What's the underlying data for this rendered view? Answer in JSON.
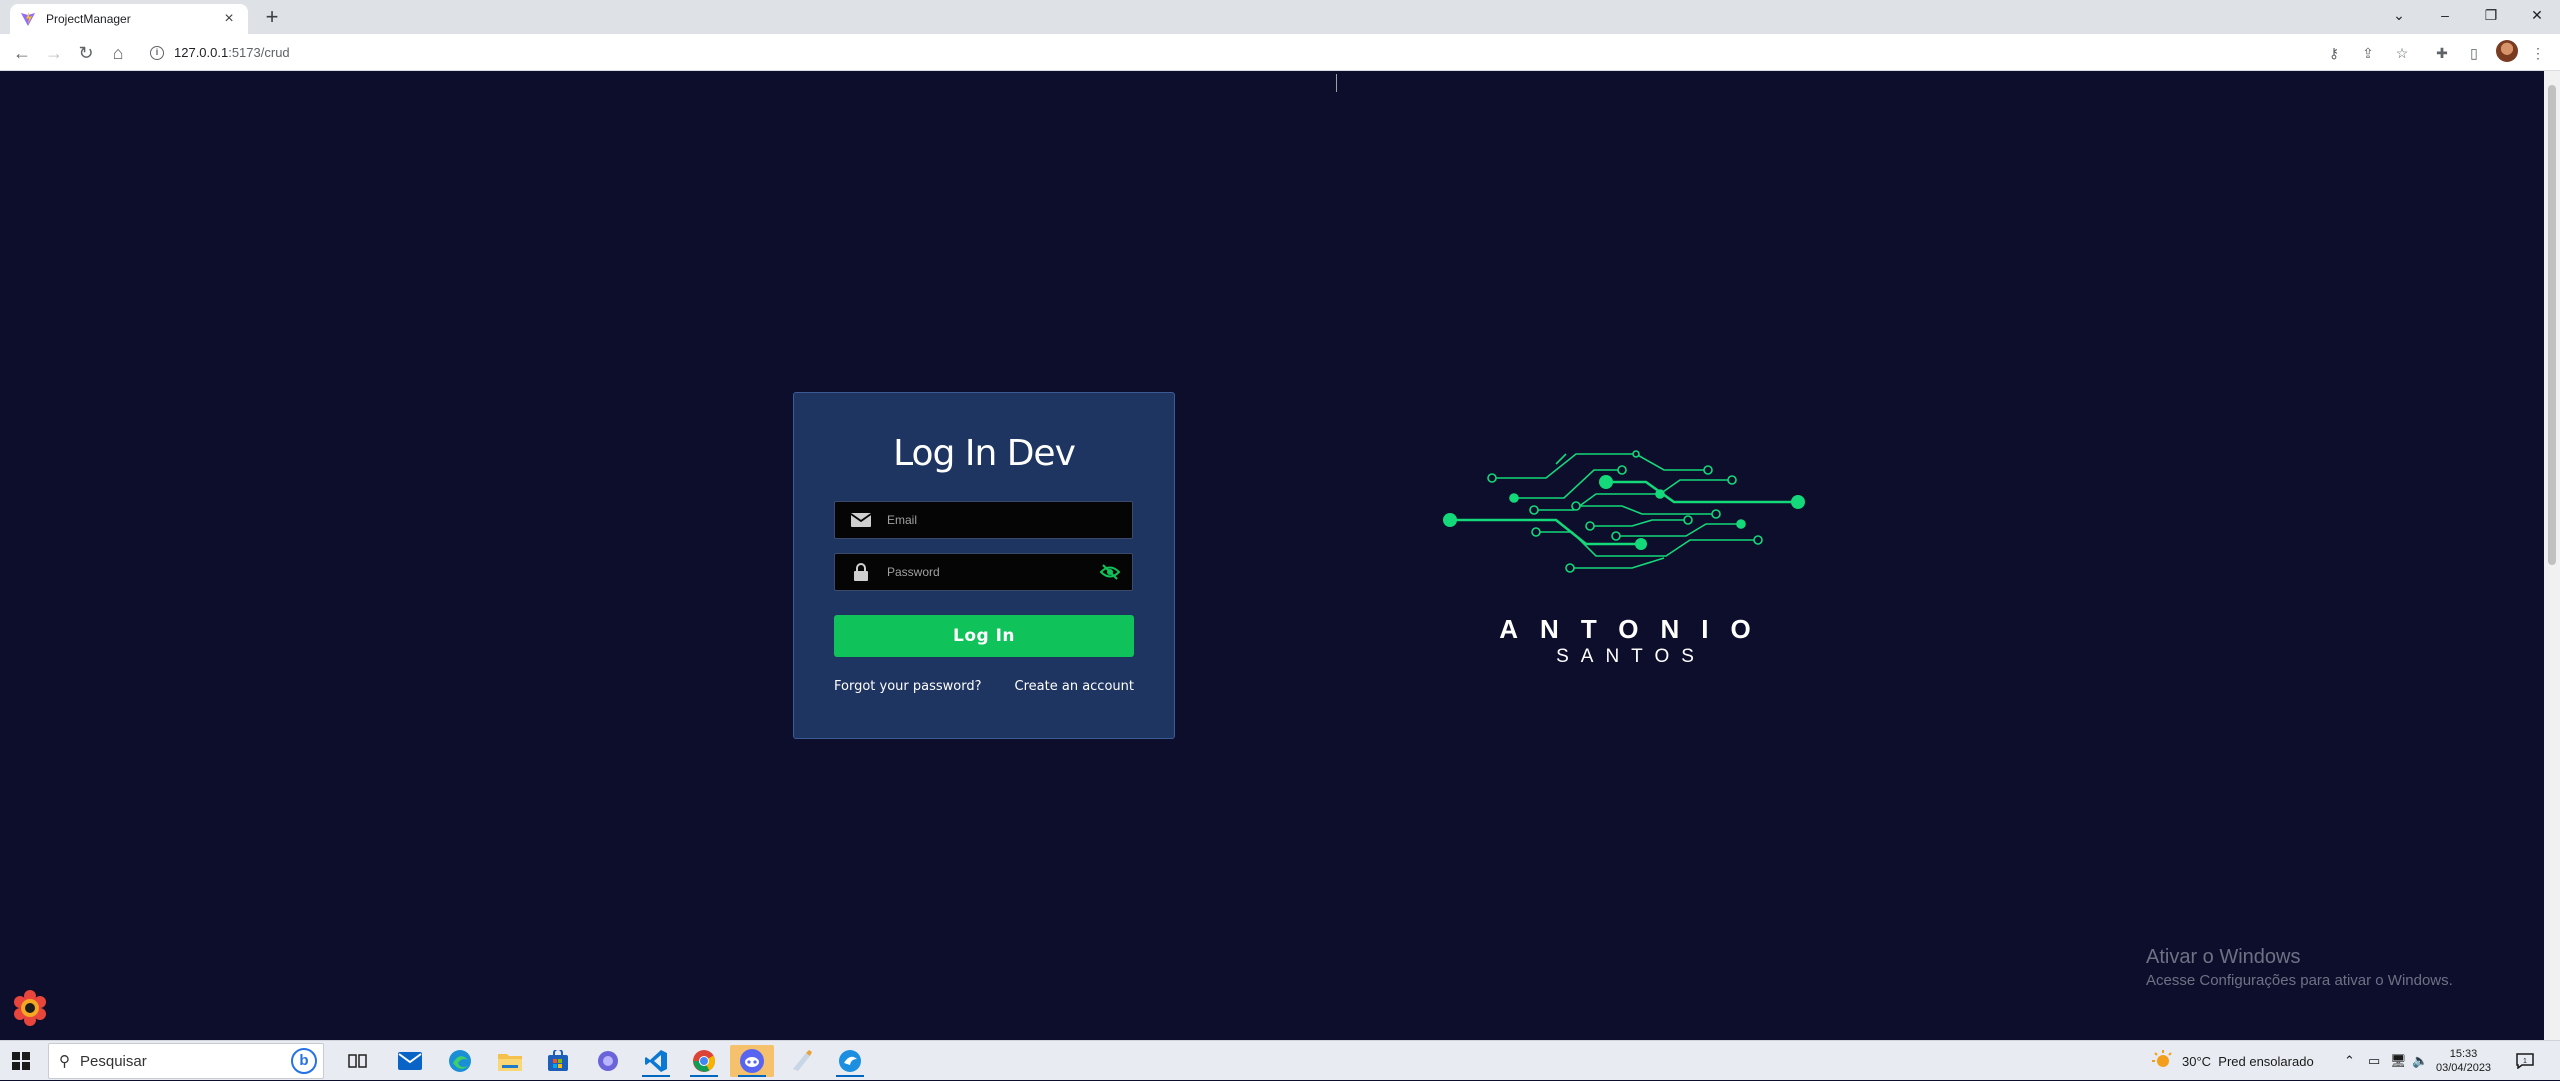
{
  "browser": {
    "tab_title": "ProjectManager",
    "tab_close": "×",
    "new_tab": "+",
    "url_host": "127.0.0.1",
    "url_rest": ":5173/crud",
    "window_controls": [
      "⌄",
      "–",
      "❐",
      "✕"
    ]
  },
  "login": {
    "title": "Log In Dev",
    "email_placeholder": "Email",
    "password_placeholder": "Password",
    "login_button": "Log In",
    "forgot_link": "Forgot your password?",
    "create_link": "Create an account",
    "accent_color": "#0fc35a"
  },
  "brand": {
    "name_line1": "ANTONIO",
    "name_line2": "SANTOS"
  },
  "watermark": {
    "line1": "Ativar o Windows",
    "line2": "Acesse Configurações para ativar o Windows."
  },
  "taskbar": {
    "search_placeholder": "Pesquisar",
    "weather": "30°C  Pred ensolarado",
    "time": "15:33",
    "date": "03/04/2023",
    "apps": [
      "bing-icon",
      "task-view-icon",
      "mail-icon",
      "edge-icon",
      "file-explorer-icon",
      "store-icon",
      "photos-icon",
      "vscode-icon",
      "chrome-icon",
      "discord-icon",
      "paint-icon",
      "app-icon"
    ]
  }
}
